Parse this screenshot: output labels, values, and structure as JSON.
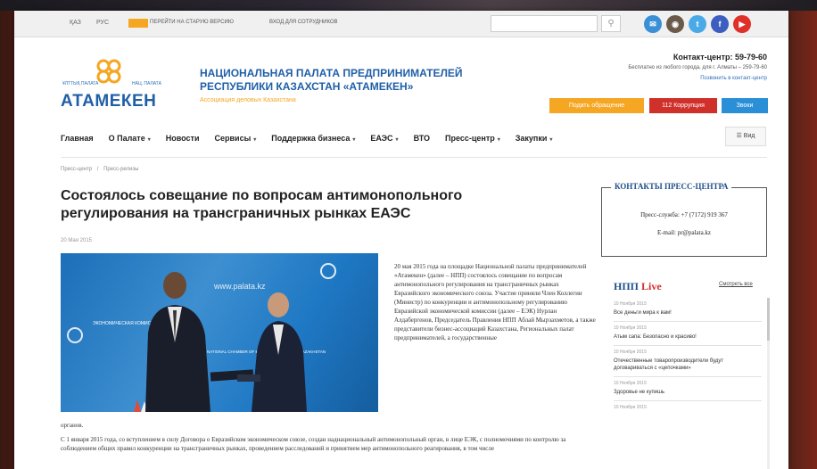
{
  "topbar": {
    "lang_kz": "ҚАЗ",
    "lang_ru": "РУС",
    "old_badge": "",
    "old_version": "ПЕРЕЙТИ НА СТАРУЮ ВЕРСИЮ",
    "staff_login": "ВХОД ДЛЯ СОТРУДНИКОВ",
    "search_placeholder": "",
    "social_colors": [
      "#3a8fd6",
      "#6b5a4a",
      "#4aaae8",
      "#3b5ec0",
      "#e0302a"
    ]
  },
  "header": {
    "logo_small_left": "ҰЛТТЫҚ ПАЛАТА",
    "logo_small_right": "НАЦ. ПАЛАТА",
    "logo_text": "АТАМЕКЕН",
    "org_title": "НАЦИОНАЛЬНАЯ ПАЛАТА ПРЕДПРИНИМАТЕЛЕЙ РЕСПУБЛИКИ КАЗАХСТАН «АТАМЕКЕН»",
    "org_sub": "Ассоциация деловых Казахстана",
    "contact_center": "Контакт-центр: 59-79-60",
    "contact_free": "Бесплатно из любого города, для г. Алматы – 259-79-60",
    "contact_link": "Позвонить в контакт-центр",
    "btn_appeal": "Подать обращение",
    "btn_corruption": "112 Коррупция",
    "btn_ngo": "Звоки",
    "btn_colors": [
      "#f5a623",
      "#d0302a",
      "#2a8fd6"
    ]
  },
  "nav": {
    "items": [
      {
        "label": "Главная",
        "caret": false
      },
      {
        "label": "О Палате",
        "caret": true
      },
      {
        "label": "Новости",
        "caret": false
      },
      {
        "label": "Сервисы",
        "caret": true
      },
      {
        "label": "Поддержка бизнеса",
        "caret": true
      },
      {
        "label": "ЕАЭС",
        "caret": true
      },
      {
        "label": "ВТО",
        "caret": false
      },
      {
        "label": "Пресс-центр",
        "caret": true
      },
      {
        "label": "Закупки",
        "caret": true
      }
    ],
    "eye_label": "Вид"
  },
  "breadcrumb": [
    "Пресс-центр",
    "/",
    "Пресс-релизы"
  ],
  "article": {
    "title": "Состоялось совещание по вопросам антимонопольного регулирования на трансграничных рынках ЕАЭС",
    "date": "20 Мая 2015",
    "photo_banner": "www.palata.kz",
    "photo_logo_left": "ЭКОНОМИЧЕСКАЯ КОМИССИЯ",
    "photo_logo_right": "NATIONAL CHAMBER OF ENTREPRENEURS OF KAZAKHSTAN",
    "side_text": "20 мая 2015 года на площадке Национальной палаты предпринимателей «Атамекен» (далее – НПП) состоялось совещание по вопросам антимонопольного регулирования на трансграничных рынках Евразийского экономического союза. Участие приняли Член Коллегии (Министр) по конкуренции и антимонопольному регулированию Евразийской экономической комиссии (далее – ЕЭК) Нурлан Алдабергенов, Председатель Правления НПП Аблай Мырзахметов, а также представители бизнес-ассоциаций Казахстана, Региональных палат предпринимателей, а государственные",
    "tail_1": "органов.",
    "tail_2": "С 1 января 2015 года, со вступлением в силу Договора о Евразийском экономическом союзе, создан наднациональный антимонопольный орган, в лице ЕЭК, с полномочиями по контролю за соблюдением общих правил конкуренции на трансграничных рынках, проведением расследований и принятием мер антимонопольного реагирования, в том числе"
  },
  "press_contacts": {
    "title": "КОНТАКТЫ ПРЕСС-ЦЕНТРА",
    "phone": "Пресс-служба: +7 (7172) 919 367",
    "email": "E-mail: pr@palata.kz"
  },
  "live": {
    "title_prefix": "НПП",
    "title_word": "Live",
    "see_all": "Смотреть все",
    "items": [
      {
        "date": "10 Ноября 2015",
        "text": "Все деньги мира к вам!"
      },
      {
        "date": "10 Ноября 2015",
        "text": "Атым сапа: Безопасно и красиво!"
      },
      {
        "date": "10 Ноября 2015",
        "text": "Отечественные товаропроизводители будут договариваться с «цепочками»"
      },
      {
        "date": "10 Ноября 2015",
        "text": "Здоровье не купишь"
      },
      {
        "date": "10 Ноября 2015",
        "text": ""
      }
    ]
  }
}
